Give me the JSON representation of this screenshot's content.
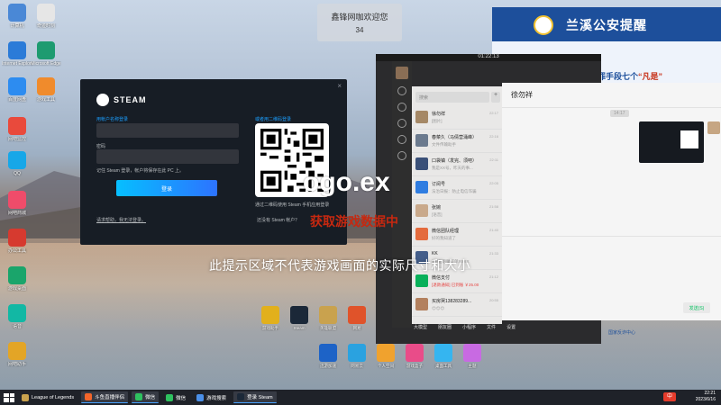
{
  "desktop": {
    "icons": [
      {
        "name": "computer",
        "label": "计算机",
        "bg": "#4a88d6"
      },
      {
        "name": "qijia",
        "label": "奇迹时刻",
        "bg": "#e6e6e6"
      },
      {
        "name": "ie",
        "label": "Internet Explorer",
        "bg": "#2b7bd8"
      },
      {
        "name": "edge",
        "label": "Microsoft Edge",
        "bg": "#1e9b70"
      },
      {
        "name": "baidu",
        "label": "百度网盘",
        "bg": "#2d8cf0"
      },
      {
        "name": "game-tool",
        "label": "游戏工具",
        "bg": "#f08b2c"
      },
      {
        "name": "monitor",
        "label": "网吧监控",
        "bg": "#e94a3c"
      },
      {
        "name": "qq",
        "label": "QQ",
        "bg": "#17a7e8"
      },
      {
        "name": "shop",
        "label": "网吧商城",
        "bg": "#ef4c6a"
      },
      {
        "name": "office",
        "label": "办公工具",
        "bg": "#d63a2f"
      },
      {
        "name": "screen",
        "label": "游戏桌面",
        "bg": "#1aa56b"
      },
      {
        "name": "chat",
        "label": "语音",
        "bg": "#12b8a4"
      },
      {
        "name": "logo",
        "label": "网吧助手",
        "bg": "#e3a526"
      }
    ]
  },
  "cafe_banner": {
    "title": "鑫锋网咖欢迎您",
    "number": "34"
  },
  "police_banner": {
    "title": "兰溪公安提醒",
    "subtitle": "犯罪手段七个",
    "highlight": "“凡是”"
  },
  "steam": {
    "logo_text": "STEAM",
    "close": "×",
    "account_label": "用帐户名称登录",
    "password_label": "密码",
    "remember_text": "记住 Steam 登录，帐户将保存在此 PC 上。",
    "login_button": "登录",
    "help_link": "请求帮助，我无法登录。",
    "qr_label": "或者用二维码登录",
    "qr_hint": "通过二维码使用 Steam 手机应用登录",
    "no_account": "还没有 Steam 帐户？"
  },
  "overlays": {
    "exe_text": "ogo.ex",
    "progress_text": "获取游戏数据中",
    "notice": "此提示区域不代表游戏画面的实际尺寸和大小"
  },
  "wechat": {
    "timer": "01:22:13",
    "search_placeholder": "搜索",
    "plus": "+",
    "chat_title": "徐勿祥",
    "time_label": "14:17",
    "send_label": "发送(S)",
    "gov_label": "国家反诈中心",
    "contacts": [
      {
        "name": "徐勿祥",
        "msg": "[图片]",
        "time": "22:17",
        "color": "#a58866",
        "red": false
      },
      {
        "name": "春菜久（马倩营涌峰）",
        "msg": "文件传输助手",
        "time": "22:16",
        "color": "#6b7a8e",
        "red": false
      },
      {
        "name": "口袋镇（发完、须吧）",
        "msg": "我是XX号，昨天的事...",
        "time": "22:11",
        "color": "#3a5078",
        "red": false
      },
      {
        "name": "订阅号",
        "msg": "法治日报：防止电信诈骗",
        "time": "22:05",
        "color": "#2f7de1",
        "red": false
      },
      {
        "name": "张婉",
        "msg": "[语音]",
        "time": "21:58",
        "color": "#c9a98b",
        "red": false
      },
      {
        "name": "微信团队经理",
        "msg": "好的我知道了",
        "time": "21:40",
        "color": "#e46b3d",
        "red": false
      },
      {
        "name": "KK",
        "msg": "[链接]跑腿订单XXXX",
        "time": "21:33",
        "color": "#445e8a",
        "red": false
      },
      {
        "name": "微信支付",
        "msg": "[退款通知] 已到账 ￥25.00",
        "time": "21:12",
        "color": "#08b05a",
        "red": true
      },
      {
        "name": "买房哭1382832​89...",
        "msg": "😊😊😊",
        "time": "20:55",
        "color": "#b3805e",
        "red": false
      }
    ],
    "bottom_labels": [
      "大模型",
      "朋友圈",
      "小程序",
      "文件",
      "设置"
    ]
  },
  "apps": [
    {
      "name": "app-1",
      "label": "游戏助手",
      "color": "#e2b01c"
    },
    {
      "name": "app-steam",
      "label": "Steam",
      "color": "#1b2838"
    },
    {
      "name": "app-3",
      "label": "英雄联盟",
      "color": "#c9a24e"
    },
    {
      "name": "app-4",
      "label": "网易",
      "color": "#e0532a"
    },
    {
      "name": "app-5",
      "label": "迅游加速",
      "color": "#1d63c7"
    },
    {
      "name": "app-6",
      "label": "网易云",
      "color": "#2aa2e0"
    },
    {
      "name": "app-7",
      "label": "个人空间",
      "color": "#f0a22e"
    },
    {
      "name": "app-8",
      "label": "游戏盒子",
      "color": "#e94c89"
    },
    {
      "name": "app-9",
      "label": "桌面工具",
      "color": "#35b5f0"
    },
    {
      "name": "app-10",
      "label": "主题",
      "color": "#c86ae2"
    }
  ],
  "taskbar": {
    "items": [
      {
        "label": "League of Legends",
        "color": "#c9a24e",
        "active": false
      },
      {
        "label": "斗鱼直播伴侣",
        "color": "#f2652a",
        "active": true
      },
      {
        "label": "微信",
        "color": "#2ec15f",
        "active": true
      },
      {
        "label": "微信",
        "color": "#2ec15f",
        "active": false
      },
      {
        "label": "游戏搜索",
        "color": "#4a8fe8",
        "active": false
      },
      {
        "label": "登录 Steam",
        "color": "#1b2838",
        "active": true
      }
    ],
    "time": "22:21",
    "date": "2023/6/16",
    "ime": "中"
  }
}
